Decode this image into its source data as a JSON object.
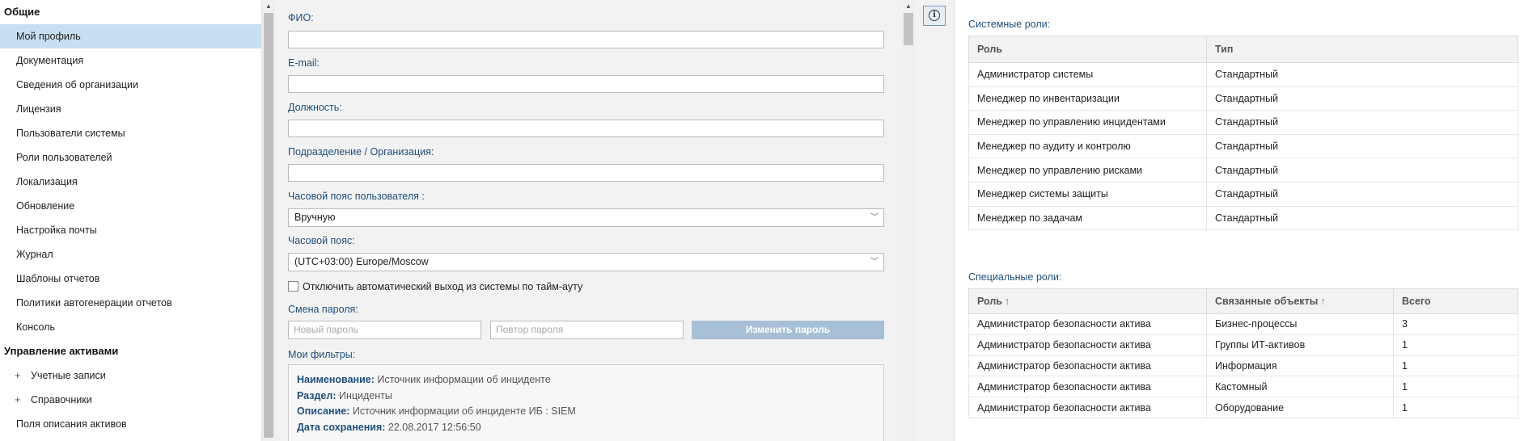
{
  "sidebar": {
    "items": [
      {
        "type": "section",
        "label": "Общие"
      },
      {
        "type": "item",
        "label": "Мой профиль",
        "active": true
      },
      {
        "type": "item",
        "label": "Документация"
      },
      {
        "type": "item",
        "label": "Сведения об организации"
      },
      {
        "type": "item",
        "label": "Лицензия"
      },
      {
        "type": "item",
        "label": "Пользователи системы"
      },
      {
        "type": "item",
        "label": "Роли пользователей"
      },
      {
        "type": "item",
        "label": "Локализация"
      },
      {
        "type": "item",
        "label": "Обновление"
      },
      {
        "type": "item",
        "label": "Настройка почты"
      },
      {
        "type": "item",
        "label": "Журнал"
      },
      {
        "type": "item",
        "label": "Шаблоны отчетов"
      },
      {
        "type": "item",
        "label": "Политики автогенерации отчетов"
      },
      {
        "type": "item",
        "label": "Консоль"
      },
      {
        "type": "section",
        "label": "Управление активами"
      },
      {
        "type": "tree",
        "label": "Учетные записи",
        "expander": "+"
      },
      {
        "type": "tree",
        "label": "Справочники",
        "expander": "+"
      },
      {
        "type": "item",
        "label": "Поля описания активов"
      }
    ]
  },
  "form": {
    "fio_label": "ФИО:",
    "email_label": "E-mail:",
    "position_label": "Должность:",
    "department_label": "Подразделение / Организация:",
    "tz_mode_label": "Часовой пояс пользователя :",
    "tz_mode_value": "Вручную",
    "tz_label": "Часовой пояс:",
    "tz_value": "(UTC+03:00) Europe/Moscow",
    "auto_logout_label": "Отключить автоматический выход из системы по тайм-ауту",
    "password_section_label": "Смена пароля:",
    "new_password_placeholder": "Новый пароль",
    "repeat_password_placeholder": "Повтор пароля",
    "change_password_button": "Изменить пароль",
    "filters_label": "Мои фильтры:",
    "filter": {
      "name_key": "Наименование:",
      "name_value": "Источник информации об инциденте",
      "section_key": "Раздел:",
      "section_value": "Инциденты",
      "desc_key": "Описание:",
      "desc_value": "Источник информации об инциденте ИБ : SIEM",
      "date_key": "Дата сохранения:",
      "date_value": "22.08.2017 12:56:50"
    }
  },
  "right": {
    "system_roles_title": "Системные роли:",
    "system_roles_headers": [
      "Роль",
      "Тип"
    ],
    "system_roles": [
      [
        "Администратор системы",
        "Стандартный"
      ],
      [
        "Менеджер по инвентаризации",
        "Стандартный"
      ],
      [
        "Менеджер по управлению инцидентами",
        "Стандартный"
      ],
      [
        "Менеджер по аудиту и контролю",
        "Стандартный"
      ],
      [
        "Менеджер по управлению рисками",
        "Стандартный"
      ],
      [
        "Менеджер системы защиты",
        "Стандартный"
      ],
      [
        "Менеджер по задачам",
        "Стандартный"
      ]
    ],
    "special_roles_title": "Специальные роли:",
    "special_roles_headers": [
      "Роль",
      "Связанные объекты",
      "Всего"
    ],
    "sort_icon": "↑",
    "special_roles": [
      [
        "Администратор безопасности актива",
        "Бизнес-процессы",
        "3"
      ],
      [
        "Администратор безопасности актива",
        "Группы ИТ-активов",
        "1"
      ],
      [
        "Администратор безопасности актива",
        "Информация",
        "1"
      ],
      [
        "Администратор безопасности актива",
        "Кастомный",
        "1"
      ],
      [
        "Администратор безопасности актива",
        "Оборудование",
        "1"
      ]
    ]
  },
  "info_button_glyph": "i"
}
